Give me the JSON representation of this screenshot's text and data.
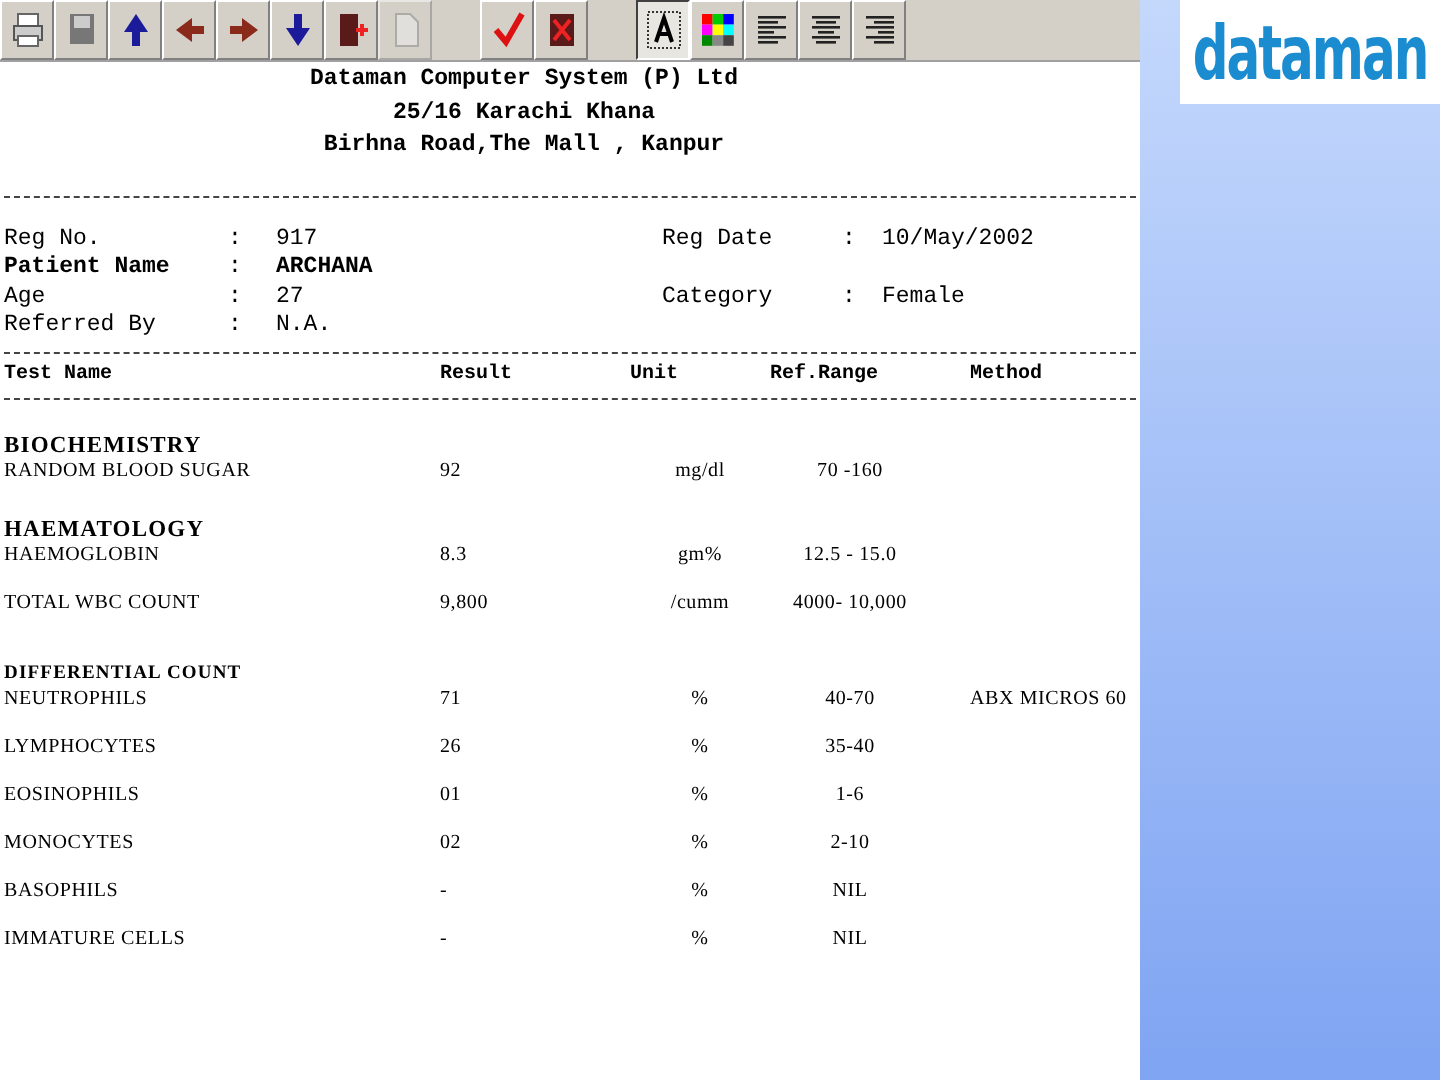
{
  "toolbar": [
    {
      "kind": "printer",
      "pressed": false,
      "disabled": false
    },
    {
      "kind": "floppy",
      "pressed": false,
      "disabled": false
    },
    {
      "kind": "up",
      "pressed": false,
      "disabled": false
    },
    {
      "kind": "left",
      "pressed": false,
      "disabled": false
    },
    {
      "kind": "right",
      "pressed": false,
      "disabled": false
    },
    {
      "kind": "down",
      "pressed": false,
      "disabled": false
    },
    {
      "kind": "exit",
      "pressed": false,
      "disabled": false
    },
    {
      "kind": "document",
      "pressed": false,
      "disabled": true
    },
    {
      "kind": "gap"
    },
    {
      "kind": "check",
      "pressed": false,
      "disabled": false
    },
    {
      "kind": "cancel",
      "pressed": false,
      "disabled": false
    },
    {
      "kind": "gap"
    },
    {
      "kind": "font",
      "pressed": true,
      "disabled": false
    },
    {
      "kind": "colors",
      "pressed": false,
      "disabled": false
    },
    {
      "kind": "align-left",
      "pressed": false,
      "disabled": false
    },
    {
      "kind": "align-center",
      "pressed": false,
      "disabled": false
    },
    {
      "kind": "align-right",
      "pressed": false,
      "disabled": false
    }
  ],
  "logo": "dataman",
  "header": [
    "Dataman Computer System (P) Ltd",
    "25/16 Karachi Khana",
    "Birhna Road,The Mall  , Kanpur"
  ],
  "patient": [
    {
      "label": "Reg No.",
      "value": "917",
      "bold": false,
      "right_label": "Reg Date",
      "right_value": "10/May/2002"
    },
    {
      "label": "Patient Name",
      "value": "ARCHANA",
      "bold": true
    },
    {
      "label": "Age",
      "value": "27",
      "bold": false,
      "right_label": "Category",
      "right_value": "Female"
    },
    {
      "label": "Referred By",
      "value": "N.A.",
      "bold": false
    }
  ],
  "separator": ":",
  "columns": [
    "Test Name",
    "Result",
    "Unit",
    "Ref.Range",
    "Method"
  ],
  "sections": [
    {
      "title": "BIOCHEMISTRY",
      "kind": "major",
      "tests": [
        {
          "name": "RANDOM BLOOD SUGAR",
          "result": "92",
          "unit": "mg/dl",
          "range": "70 -160"
        }
      ]
    },
    {
      "title": "HAEMATOLOGY",
      "kind": "major",
      "tests": [
        {
          "name": "HAEMOGLOBIN",
          "result": "8.3",
          "unit": "gm%",
          "range": "12.5 - 15.0"
        },
        {
          "name": "TOTAL WBC COUNT",
          "result": "9,800",
          "unit": "/cumm",
          "range": "4000- 10,000"
        }
      ]
    },
    {
      "title": "DIFFERENTIAL COUNT",
      "kind": "minor",
      "tests": [
        {
          "name": "NEUTROPHILS",
          "result": "71",
          "unit": "%",
          "range": "40-70",
          "method": "ABX MICROS 60"
        },
        {
          "name": "LYMPHOCYTES",
          "result": "26",
          "unit": "%",
          "range": "35-40"
        },
        {
          "name": "EOSINOPHILS",
          "result": "01",
          "unit": "%",
          "range": "1-6"
        },
        {
          "name": "MONOCYTES",
          "result": "02",
          "unit": "%",
          "range": "2-10"
        },
        {
          "name": "BASOPHILS",
          "result": "-",
          "unit": "%",
          "range": "NIL"
        },
        {
          "name": "IMMATURE CELLS",
          "result": "-",
          "unit": "%",
          "range": "NIL"
        }
      ]
    }
  ]
}
